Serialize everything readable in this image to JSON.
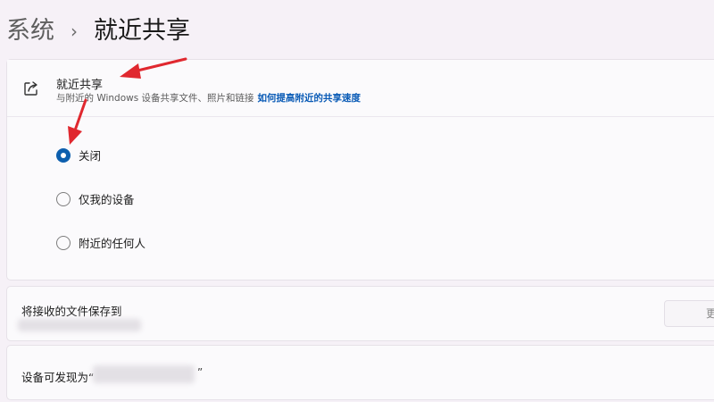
{
  "breadcrumb": {
    "parent": "系统",
    "separator": "›",
    "current": "就近共享"
  },
  "nearby_sharing": {
    "title": "就近共享",
    "description": "与附近的 Windows 设备共享文件、照片和链接",
    "link": "如何提高附近的共享速度",
    "icon": "share-icon",
    "options": [
      {
        "label": "关闭",
        "selected": true
      },
      {
        "label": "仅我的设备",
        "selected": false
      },
      {
        "label": "附近的任何人",
        "selected": false
      }
    ]
  },
  "save_location": {
    "label": "将接收的文件保存到",
    "button_label": "更"
  },
  "discoverable": {
    "label": "设备可发现为“",
    "closing_quote": "”"
  },
  "annotation_color": "#e0282f",
  "accent_color": "#0d5fae",
  "link_color": "#0a5bb6"
}
